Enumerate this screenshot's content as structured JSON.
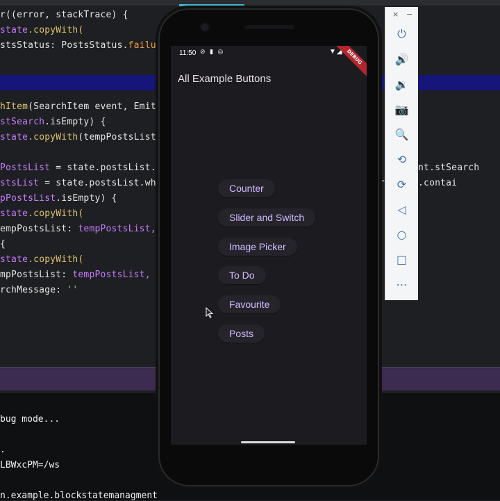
{
  "ide": {
    "code_lines": [
      {
        "segments": [
          {
            "t": "r((error, stackTrace) {",
            "c": ""
          }
        ]
      },
      {
        "segments": [
          {
            "t": "state",
            "c": "kw-purple"
          },
          {
            "t": ".copyWith(",
            "c": "kw-yellow"
          }
        ]
      },
      {
        "segments": [
          {
            "t": "stsStatus: ",
            "c": ""
          },
          {
            "t": "PostsStatus",
            "c": ""
          },
          {
            "t": ".",
            "c": ""
          },
          {
            "t": "failure",
            "c": "kw-orange"
          }
        ]
      },
      {
        "segments": [
          {
            "t": "",
            "c": ""
          }
        ]
      },
      {
        "segments": [
          {
            "t": "",
            "c": ""
          }
        ]
      },
      {
        "segments": [
          {
            "t": "",
            "c": ""
          }
        ]
      },
      {
        "segments": [
          {
            "t": "hItem",
            "c": "kw-yellow"
          },
          {
            "t": "(SearchItem event, Emit",
            "c": ""
          }
        ]
      },
      {
        "segments": [
          {
            "t": "stSearch",
            "c": "kw-purple"
          },
          {
            "t": ".isEmpty) {",
            "c": ""
          }
        ]
      },
      {
        "segments": [
          {
            "t": "state",
            "c": "kw-purple"
          },
          {
            "t": ".copyWith",
            "c": "kw-yellow"
          },
          {
            "t": "(tempPostsList:",
            "c": ""
          }
        ]
      },
      {
        "segments": [
          {
            "t": "",
            "c": ""
          }
        ]
      },
      {
        "segments": [
          {
            "t": "PostsList",
            "c": "kw-purple"
          },
          {
            "t": " = state.postsList.w",
            "c": ""
          },
          {
            "t": "                                  n        event.stSearch",
            "c": ""
          }
        ]
      },
      {
        "segments": [
          {
            "t": "stsList",
            "c": "kw-purple"
          },
          {
            "t": " = state.postsList.wher",
            "c": ""
          },
          {
            "t": "                                 )   erCase().contai",
            "c": ""
          }
        ]
      },
      {
        "segments": [
          {
            "t": "pPostsList",
            "c": "kw-purple"
          },
          {
            "t": ".isEmpty) {",
            "c": ""
          }
        ]
      },
      {
        "segments": [
          {
            "t": "state",
            "c": "kw-purple"
          },
          {
            "t": ".copyWith(",
            "c": "kw-yellow"
          }
        ]
      },
      {
        "segments": [
          {
            "t": "empPostsList: ",
            "c": ""
          },
          {
            "t": "tempPostsList,",
            "c": "kw-purple"
          }
        ]
      },
      {
        "segments": [
          {
            "t": "{",
            "c": ""
          }
        ]
      },
      {
        "segments": [
          {
            "t": "state",
            "c": "kw-purple"
          },
          {
            "t": ".copyWith(",
            "c": "kw-yellow"
          }
        ]
      },
      {
        "segments": [
          {
            "t": "mpPostsList: ",
            "c": ""
          },
          {
            "t": "tempPostsList,",
            "c": "kw-purple"
          }
        ]
      },
      {
        "segments": [
          {
            "t": "rchMessage: ",
            "c": ""
          },
          {
            "t": "''",
            "c": "kw-str"
          }
        ]
      }
    ],
    "console_lines": [
      "bug mode...",
      "",
      ".",
      "LBWxcPM=/ws",
      "",
      "n.example.blockstatemanagment"
    ]
  },
  "emulator_toolbar": {
    "close_label": "×",
    "minimize_label": "−",
    "tools": [
      {
        "name": "power-icon",
        "glyph": "⏻"
      },
      {
        "name": "volume-up-icon",
        "glyph": "🔊"
      },
      {
        "name": "volume-down-icon",
        "glyph": "🔉"
      },
      {
        "name": "camera-icon",
        "glyph": "📷"
      },
      {
        "name": "zoom-icon",
        "glyph": "🔍"
      },
      {
        "name": "rotate-left-icon",
        "glyph": "⟲"
      },
      {
        "name": "rotate-right-icon",
        "glyph": "⟳"
      },
      {
        "name": "back-icon",
        "glyph": "◁"
      },
      {
        "name": "home-icon",
        "glyph": "○"
      },
      {
        "name": "overview-icon",
        "glyph": "□"
      },
      {
        "name": "more-icon",
        "glyph": "⋯"
      }
    ]
  },
  "phone": {
    "status_time": "11:50",
    "status_left_icons": "⊘ ▮ ◎",
    "status_right_icons": "▼◢ ▮",
    "debug_label": "DEBUG",
    "app_title": "All Example Buttons",
    "buttons": [
      {
        "label": "Counter"
      },
      {
        "label": "Slider and Switch"
      },
      {
        "label": "Image Picker"
      },
      {
        "label": "To Do"
      },
      {
        "label": "Favourite"
      },
      {
        "label": "Posts"
      }
    ]
  },
  "colors": {
    "button_text": "#cfbcff",
    "button_bg": "#26242b",
    "screen_bg": "#1c1b1f",
    "ide_highlight": "#15157a",
    "emulator_accent": "#3e6fb0"
  }
}
